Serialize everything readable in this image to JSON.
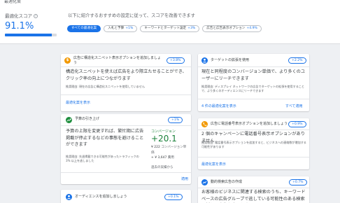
{
  "header": {
    "crumb": "最適化案",
    "score_label": "最適化スコア",
    "score_help": "?",
    "score_value": "91.1%",
    "score_fraction": 0.911,
    "intro": "以下に紹介するおすすめの設定に従って、スコアを改善できます",
    "chips": [
      {
        "label": "すべての最適化案",
        "delta": ""
      },
      {
        "label": "入札と予算",
        "delta": "+1%"
      },
      {
        "label": "キーワードとターゲット設定",
        "delta": "+3%"
      },
      {
        "label": "広告と広告表示オプション",
        "delta": "+4.9%"
      }
    ]
  },
  "cards": {
    "c1": {
      "icon": "$",
      "title": "広告に構造化スニペット表示オプションを追加しましょう",
      "badge": "+3.8%",
      "body": "構造化スニペットを使えば広告をより際立たせることができ、クリック率の向上につながります",
      "note": "推奨理由: 現在の広告に構造化スニペットを使用していません",
      "link": "最適化案を表示"
    },
    "c2": {
      "title": "予算の引き上げ",
      "badge": "+1%",
      "body": "予算の上限を変更すれば、繁忙期に広告掲載が停止するなどの事態を避けることができます",
      "note": "推奨理由: 先週掲載できる可能性があったトラフィックの 3% 以上を逃しました",
      "conv_head": "コンバージョン",
      "conv_value": "+20.1",
      "conv_cost": "¥ 222",
      "conv_cost_label": "コンバージョン単価",
      "conv_spend": "+ ¥ 3,647",
      "conv_spend_label": "費用",
      "conv_foot": "過去の実績から",
      "link": "適用"
    },
    "c3": {
      "title": "オーディエンスを追加しましょう",
      "badge": "+0.1%"
    },
    "c4": {
      "title": "ターゲットの拡張を使用",
      "badge": "+2.2%",
      "body": "現在と同程度のコンバージョン単価で、より多くのユーザーにリーチできます",
      "note": "推奨理由: ディスプレイ ネットワークの広告でターゲットの拡張を使用すること で、より多くのオーディエンスにリーチできます",
      "link_left": "4 件の最適化案を表示",
      "link_right": "すべて適用"
    },
    "c5": {
      "title": "広告に電話番号表示オプションを追加しましょう",
      "badge": "+0.9%",
      "body": "2 個のキャンペーンに電話番号表示オプションがありません",
      "note": "推奨理由: 電話番号表示オプションを追加すると、ビジネスへの連絡数が増加する可能性があります",
      "link": "最適化案を表示"
    },
    "c6": {
      "title": "動的検索広告の作成",
      "badge": "+0.7%",
      "body": "お客様のビジネスに関連する検索のうち、キーワードベースの広告グループで逃している可能性のある検索に対して広告を表示しま"
    }
  },
  "colors": {
    "accent": "#1a73e8",
    "orange_icon": "#f29900",
    "green_icon": "#1e8e3e",
    "blue_icon": "#1a73e8",
    "conversion_green": "#188038"
  }
}
